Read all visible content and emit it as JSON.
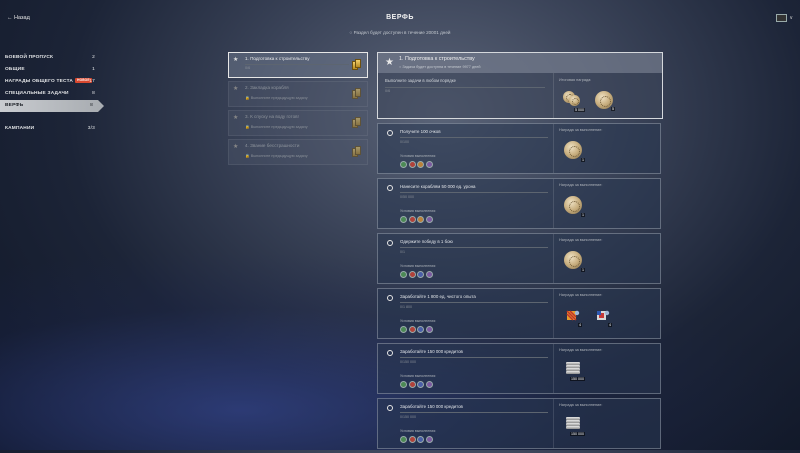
{
  "header": {
    "back_label": "← Назад",
    "title": "ВЕРФЬ",
    "subtitle": "○  Раздел будет доступен в течение 20001 дней",
    "lang_label": "∨"
  },
  "nav": [
    {
      "label": "БОЕВОЙ ПРОПУСК",
      "count": "2"
    },
    {
      "label": "ОБЩИЕ",
      "count": "1"
    },
    {
      "label": "НАГРАДЫ ОБЩЕГО ТЕСТА",
      "count": "17",
      "badge": "НОВОЕ"
    },
    {
      "label": "СПЕЦИАЛЬНЫЕ ЗАДАЧИ",
      "count": "8"
    },
    {
      "label": "ВЕРФЬ",
      "count": "8"
    },
    {
      "label": "КАМПАНИИ",
      "count": "3/3"
    }
  ],
  "stages": [
    {
      "title": "1. Подготовка к строительству",
      "sub": "0/6"
    },
    {
      "title": "2. Закладка корабля",
      "sub": "🔒 Выполните предыдущую задачу"
    },
    {
      "title": "3. К спуску на воду готов!",
      "sub": "🔒 Выполните предыдущую задачу"
    },
    {
      "title": "4. Звание бесстрашности",
      "sub": "🔒 Выполните предыдущую задачу"
    }
  ],
  "panel": {
    "title": "1. Подготовка к строительству",
    "note": "○  Задача будет доступна в течение 9977 дней",
    "task": "Выполните задачи в любом порядке",
    "progress": "0/6",
    "reward_label": "Итоговая награда:",
    "reward_qty_1": "5 000",
    "reward_qty_2": "5"
  },
  "tasks": [
    {
      "title": "Получите 100 очков",
      "progress": "0/100",
      "cond": "Условия выполнения:",
      "reward_label": "Награда за выполнение:",
      "qty": "1",
      "kind": "coin"
    },
    {
      "title": "Нанесите кораблям 50 000 ед. урона",
      "progress": "0/50 000",
      "cond": "Условия выполнения:",
      "reward_label": "Награда за выполнение:",
      "qty": "1",
      "kind": "coin"
    },
    {
      "title": "Одержите победу в 1 бою",
      "progress": "0/1",
      "cond": "Условия выполнения:",
      "reward_label": "Награда за выполнение:",
      "qty": "1",
      "kind": "coin"
    },
    {
      "title": "Заработайте 1 800 ед. чистого опыта",
      "progress": "0/1 800",
      "cond": "Условия выполнения:",
      "reward_label": "Награда за выполнение:",
      "qty": "4",
      "qty2": "4",
      "kind": "flags"
    },
    {
      "title": "Заработайте 150 000 кредитов",
      "progress": "0/150 000",
      "cond": "Условия выполнения:",
      "reward_label": "Награда за выполнение:",
      "qty": "150 000",
      "kind": "credits"
    },
    {
      "title": "Заработайте 150 000 кредитов",
      "progress": "0/150 000",
      "cond": "Условия выполнения:",
      "reward_label": "Награда за выполнение:",
      "qty": "150 000",
      "kind": "credits"
    }
  ],
  "colors": {
    "accent_badge": "#d8482f",
    "active_nav": "#c9ccd0"
  }
}
